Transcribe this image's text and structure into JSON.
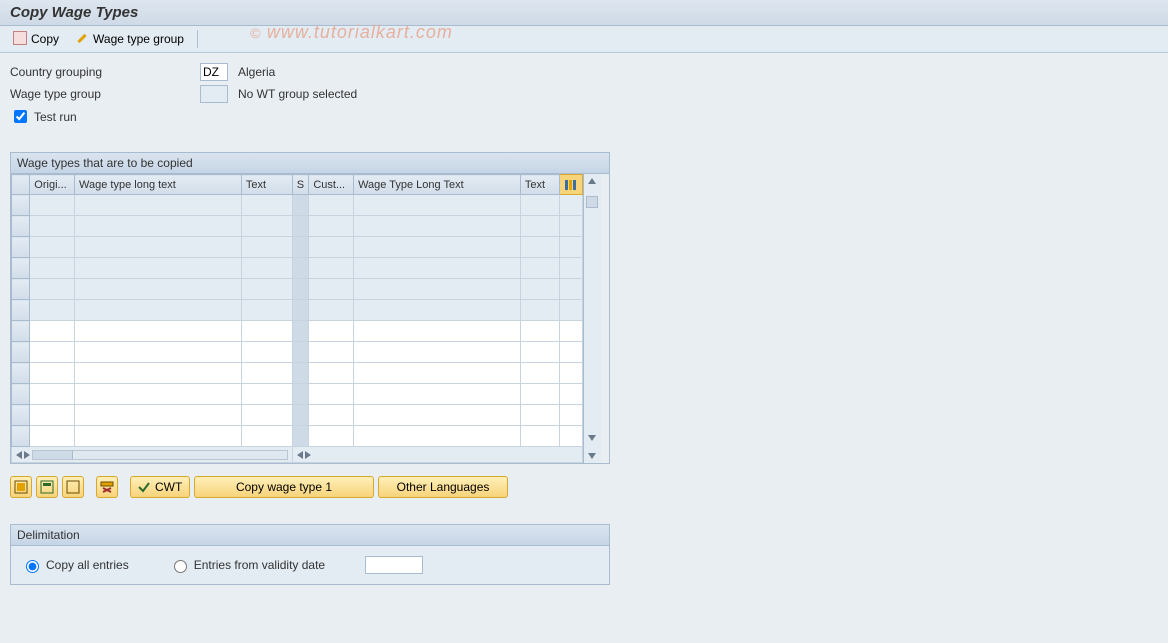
{
  "title": "Copy Wage Types",
  "toolbar": {
    "copy_label": "Copy",
    "wage_type_group_label": "Wage type group"
  },
  "watermark": "www.tutorialkart.com",
  "form": {
    "country_grouping_label": "Country grouping",
    "country_grouping_value": "DZ",
    "country_grouping_desc": "Algeria",
    "wage_type_group_label": "Wage type group",
    "wage_type_group_value": "",
    "wage_type_group_desc": "No WT group selected",
    "test_run_label": "Test run",
    "test_run_checked": true
  },
  "table": {
    "title": "Wage types that are to be copied",
    "columns": {
      "origi": "Origi...",
      "long_text_a": "Wage type long text",
      "text_a": "Text",
      "s": "S",
      "cust": "Cust...",
      "long_text_b": "Wage Type Long Text",
      "text_b": "Text"
    },
    "visible_row_count": 12
  },
  "buttons": {
    "cwt_label": "CWT",
    "copy_wt1_label": "Copy wage type 1",
    "other_lang_label": "Other Languages"
  },
  "delimitation": {
    "title": "Delimitation",
    "copy_all_label": "Copy all entries",
    "entries_from_label": "Entries from validity date",
    "selected": "copy_all",
    "date_value": ""
  }
}
